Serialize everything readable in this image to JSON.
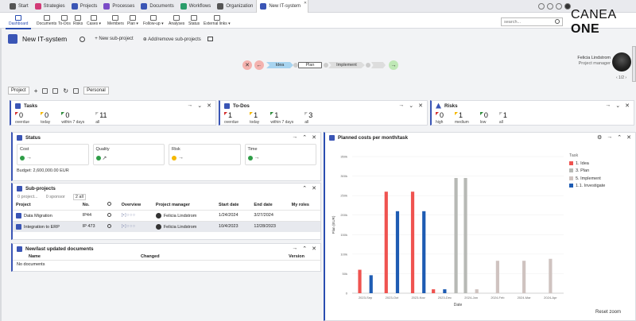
{
  "tabs": [
    {
      "label": "Start",
      "icon": "home-icon",
      "color": "#555"
    },
    {
      "label": "Strategies",
      "icon": "strategies-icon",
      "color": "#d23a77"
    },
    {
      "label": "Projects",
      "icon": "projects-icon",
      "color": "#3a55b5"
    },
    {
      "label": "Processes",
      "icon": "processes-icon",
      "color": "#7a4bc7"
    },
    {
      "label": "Documents",
      "icon": "documents-icon",
      "color": "#3a55b5"
    },
    {
      "label": "Workflows",
      "icon": "workflows-icon",
      "color": "#2a9d6a"
    },
    {
      "label": "Organization",
      "icon": "organization-icon",
      "color": "#555"
    },
    {
      "label": "New IT-system",
      "icon": "project-tab-icon",
      "color": "#3a55b5",
      "active": true
    }
  ],
  "toolbar": [
    "Dashboard",
    "Documents",
    "To-Dos",
    "Risks",
    "Cases ▾",
    "Members",
    "Plan ▾",
    "Follow-up ▾",
    "Analyses",
    "Status",
    "External links ▾"
  ],
  "search": {
    "placeholder": "search..."
  },
  "logo": {
    "text": "CANEA ",
    "bold": "ONE"
  },
  "project": {
    "title": "New IT-system",
    "new_sub": "+ New sub-project",
    "add_remove": "Add/remove sub-projects"
  },
  "lifecycle": {
    "phases": [
      "Idea",
      "Plan",
      "Implement"
    ],
    "active": "Plan"
  },
  "manager": {
    "name": "Felicia Lindstrom",
    "role": "Project manager",
    "pager": "‹ 1/2 ›"
  },
  "tabbar": {
    "project": "Project",
    "personal": "Personal"
  },
  "tasks": {
    "title": "Tasks",
    "items": [
      {
        "value": "0",
        "label": "overdue",
        "color": "#d32f2f"
      },
      {
        "value": "0",
        "label": "today",
        "color": "#f5b800"
      },
      {
        "value": "0",
        "label": "within 7 days",
        "color": "#2e8b3a"
      },
      {
        "value": "11",
        "label": "all",
        "color": "#bbb"
      }
    ]
  },
  "todos": {
    "title": "To-Dos",
    "items": [
      {
        "value": "1",
        "label": "overdue",
        "color": "#d32f2f"
      },
      {
        "value": "1",
        "label": "today",
        "color": "#f5b800"
      },
      {
        "value": "1",
        "label": "within 7 days",
        "color": "#2e8b3a"
      },
      {
        "value": "3",
        "label": "all",
        "color": "#bbb"
      }
    ]
  },
  "risks": {
    "title": "Risks",
    "items": [
      {
        "value": "0",
        "label": "high",
        "color": "#d32f2f"
      },
      {
        "value": "1",
        "label": "medium",
        "color": "#f5b800"
      },
      {
        "value": "0",
        "label": "low",
        "color": "#2e8b3a"
      },
      {
        "value": "1",
        "label": "all",
        "color": "#bbb"
      }
    ]
  },
  "status": {
    "title": "Status",
    "boxes": [
      {
        "label": "Cost",
        "color": "#2e9d47",
        "arrow": "→"
      },
      {
        "label": "Quality",
        "color": "#2e9d47",
        "arrow": "↗"
      },
      {
        "label": "Risk",
        "color": "#f5b800",
        "arrow": "→"
      },
      {
        "label": "Time",
        "color": "#2e9d47",
        "arrow": "→"
      }
    ],
    "budget": "Budget: 2,600,000.00 EUR"
  },
  "subprojects": {
    "title": "Sub-projects",
    "tabs": [
      "0 project...",
      "0 sponsor",
      "2 all"
    ],
    "columns": [
      "Project",
      "No.",
      "",
      "Overview",
      "Project manager",
      "Start date",
      "End date",
      "My roles"
    ],
    "rows": [
      {
        "project": "Data Migration",
        "no": "IP44",
        "overview": "[▪]○○○",
        "pm": "Felicia Lindstrom",
        "start": "1/24/2024",
        "end": "3/27/2024",
        "roles": ""
      },
      {
        "project": "Integration to ERP",
        "no": "IP 473",
        "overview": "[▪]○○○",
        "pm": "Felicia Lindstrom",
        "start": "10/4/2023",
        "end": "12/28/2023",
        "roles": ""
      }
    ]
  },
  "documents": {
    "title": "New/last updated documents",
    "columns": [
      "Name",
      "Changed",
      "Version"
    ],
    "empty": "No documents"
  },
  "chart_data": {
    "type": "bar",
    "title": "Planned costs per month/task",
    "xlabel": "Date",
    "ylabel": "Plan (EUR)",
    "ylim": [
      0,
      350000
    ],
    "yticks": [
      "0",
      "50k",
      "100k",
      "150k",
      "200k",
      "250k",
      "300k",
      "350k"
    ],
    "categories": [
      "2023-Sep",
      "2023-Oct",
      "2023-Nov",
      "2023-Dec",
      "2024-Jan",
      "2024-Feb",
      "2024-Mar",
      "2024-Apr"
    ],
    "legend_title": "Task",
    "series": [
      {
        "name": "1. Idea",
        "color": "#ef5350",
        "values": [
          60000,
          260000,
          260000,
          10000,
          0,
          0,
          0,
          0
        ]
      },
      {
        "name": "3. Plan",
        "color": "#b7b9b5",
        "values": [
          0,
          0,
          0,
          295000,
          295000,
          0,
          0,
          0
        ]
      },
      {
        "name": "5. Implement",
        "color": "#cfc3c0",
        "values": [
          0,
          0,
          0,
          0,
          10000,
          83000,
          83000,
          88000
        ]
      },
      {
        "name": "1.1. Investigate",
        "color": "#1e5cb3",
        "values": [
          46000,
          210000,
          210000,
          10000,
          0,
          0,
          0,
          0
        ]
      }
    ],
    "reset": "Reset zoom"
  }
}
